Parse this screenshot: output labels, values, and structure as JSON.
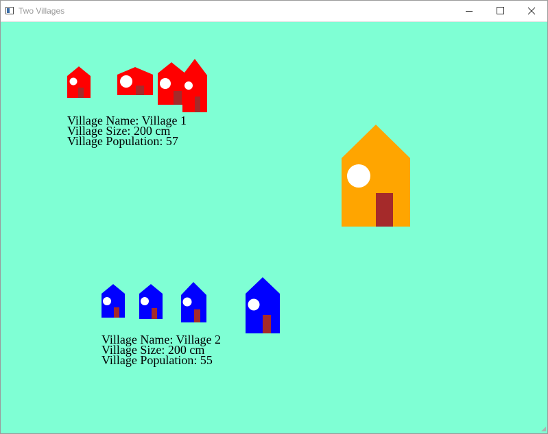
{
  "window": {
    "title": "Two Villages",
    "icon": "app-window-icon",
    "controls": [
      "minimize-icon",
      "maximize-icon",
      "close-icon"
    ]
  },
  "canvas": {
    "background": "#7fffd4"
  },
  "colors": {
    "village1_house": "#ff0000",
    "village2_house": "#0000ff",
    "standalone_house": "#ffa500",
    "door": "#a52a2a",
    "window": "#ffffff"
  },
  "villages": [
    {
      "house_count": 4,
      "lines": [
        "Village Name: Village 1",
        "Village Size: 200 cm",
        "Village Population: 57"
      ]
    },
    {
      "house_count": 4,
      "lines": [
        "Village Name: Village 2",
        "Village Size: 200 cm",
        "Village Population: 55"
      ]
    }
  ],
  "standalone_house_count": 1
}
